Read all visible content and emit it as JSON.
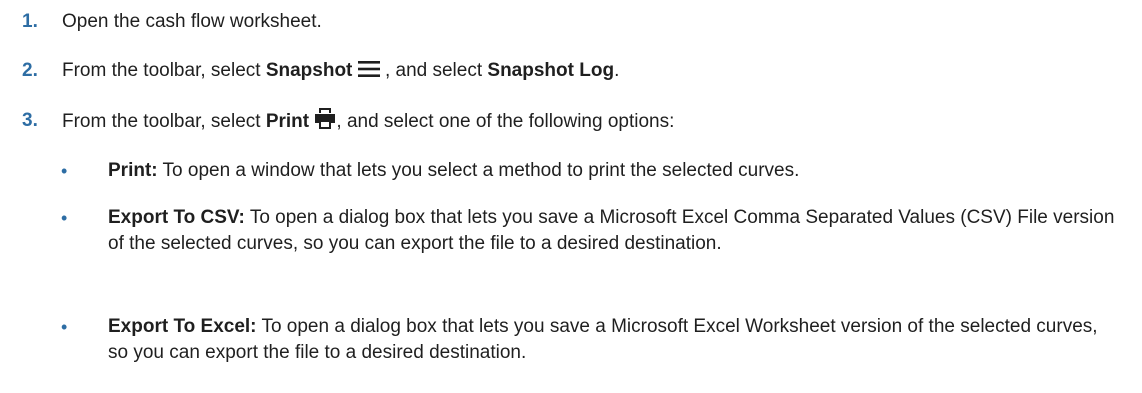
{
  "steps": [
    {
      "number": "1.",
      "text": "Open the cash flow worksheet."
    },
    {
      "number": "2.",
      "prefix": "From the toolbar, select ",
      "bold1": "Snapshot",
      "icon": "menu-icon",
      "middle": " , and select ",
      "bold2": "Snapshot Log",
      "suffix": "."
    },
    {
      "number": "3.",
      "prefix": "From the toolbar, select ",
      "bold1": "Print",
      "icon": "print-icon",
      "suffix": ", and select one of the following options:"
    }
  ],
  "options": [
    {
      "bullet": "•",
      "label": "Print:",
      "text": " To open a window that lets you select a method to print the selected curves."
    },
    {
      "bullet": "•",
      "label": "Export To CSV:",
      "text": " To open a dialog box that lets you save a Microsoft Excel Comma Separated Values (CSV) File version of the selected curves, so you can export the file to a desired destination."
    },
    {
      "bullet": "•",
      "label": "Export To Excel:",
      "text": " To open a dialog box that lets you save a Microsoft Excel Worksheet version of the selected curves, so you can export the file to a desired destination."
    }
  ],
  "colors": {
    "accent": "#2d6da4",
    "text": "#1f1f1f"
  }
}
